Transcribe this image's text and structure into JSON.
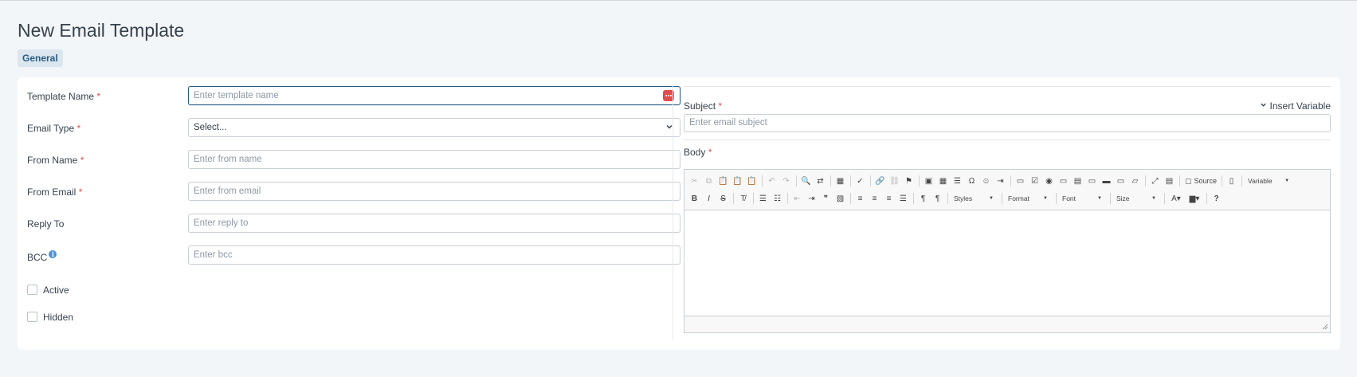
{
  "page": {
    "title": "New Email Template",
    "tab_general": "General"
  },
  "form": {
    "required_mark": "*",
    "template_name": {
      "label": "Template Name",
      "placeholder": "Enter template name"
    },
    "email_type": {
      "label": "Email Type",
      "value": "Select..."
    },
    "from_name": {
      "label": "From Name",
      "placeholder": "Enter from name"
    },
    "from_email": {
      "label": "From Email",
      "placeholder": "Enter from email"
    },
    "reply_to": {
      "label": "Reply To",
      "placeholder": "Enter reply to"
    },
    "bcc": {
      "label": "BCC",
      "placeholder": "Enter bcc",
      "info_glyph": "i"
    },
    "active": {
      "label": "Active",
      "checked": false
    },
    "hidden": {
      "label": "Hidden",
      "checked": false
    }
  },
  "right": {
    "subject": {
      "label": "Subject",
      "placeholder": "Enter email subject"
    },
    "insert_variable": "Insert Variable",
    "body": {
      "label": "Body"
    }
  },
  "editor": {
    "source_label": "Source",
    "variable_label": "Variable",
    "styles_label": "Styles",
    "format_label": "Format",
    "font_label": "Font",
    "size_label": "Size",
    "help_glyph": "?",
    "bold": "B",
    "italic": "I",
    "strike": "S",
    "omega": "Ω"
  },
  "colors": {
    "accent": "#2a5d84",
    "required": "#e24c4c",
    "info": "#4a90d9"
  }
}
